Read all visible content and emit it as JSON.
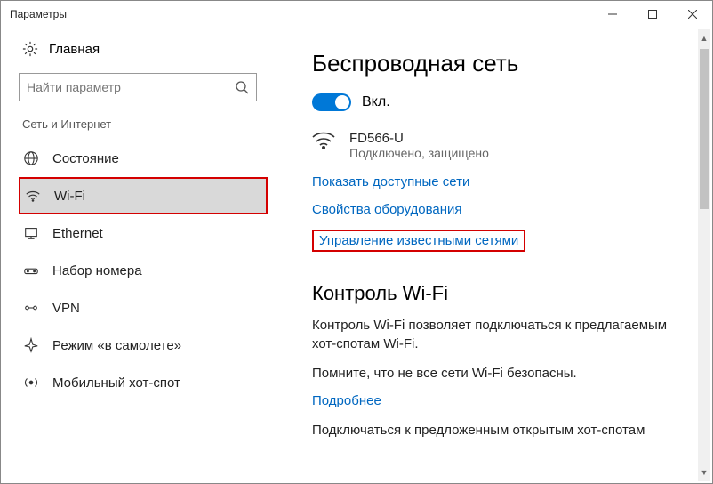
{
  "window": {
    "title": "Параметры"
  },
  "sidebar": {
    "home": "Главная",
    "search_placeholder": "Найти параметр",
    "category": "Сеть и Интернет",
    "items": [
      {
        "label": "Состояние"
      },
      {
        "label": "Wi-Fi"
      },
      {
        "label": "Ethernet"
      },
      {
        "label": "Набор номера"
      },
      {
        "label": "VPN"
      },
      {
        "label": "Режим «в самолете»"
      },
      {
        "label": "Мобильный хот-спот"
      }
    ]
  },
  "main": {
    "heading": "Беспроводная сеть",
    "toggle_label": "Вкл.",
    "network": {
      "name": "FD566-U",
      "status": "Подключено, защищено"
    },
    "links": {
      "show_networks": "Показать доступные сети",
      "hardware_props": "Свойства оборудования",
      "manage_known": "Управление известными сетями"
    },
    "wifi_sense": {
      "heading": "Контроль Wi-Fi",
      "desc": "Контроль Wi-Fi позволяет подключаться к предлагаемым хот-спотам Wi-Fi.",
      "note": "Помните, что не все сети Wi-Fi безопасны.",
      "more": "Подробнее",
      "connect_suggested": "Подключаться к предложенным открытым хот-спотам"
    }
  }
}
